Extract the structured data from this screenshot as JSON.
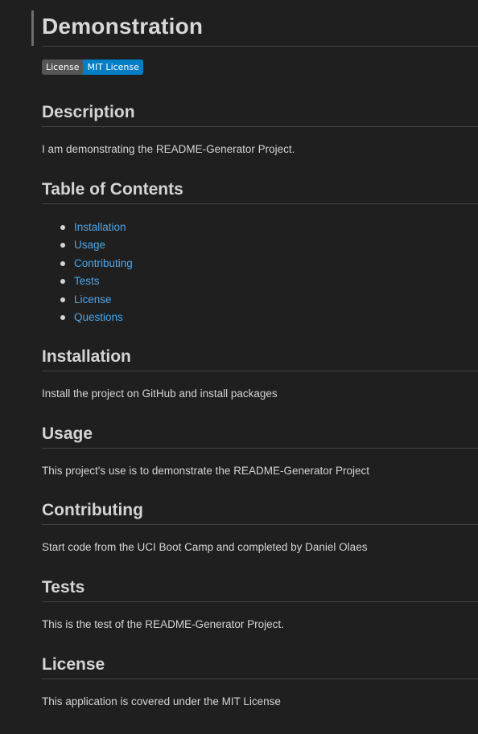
{
  "title": "Demonstration",
  "badge": {
    "left": "License",
    "right": "MIT License",
    "left_color": "#555555",
    "right_color": "#007ec6"
  },
  "sections": {
    "description": {
      "heading": "Description",
      "text": "I am demonstrating the README-Generator Project."
    },
    "toc": {
      "heading": "Table of Contents",
      "items": [
        "Installation",
        "Usage",
        "Contributing",
        "Tests",
        "License",
        "Questions"
      ]
    },
    "installation": {
      "heading": "Installation",
      "text": "Install the project on GitHub and install packages"
    },
    "usage": {
      "heading": "Usage",
      "text": "This project's use is to demonstrate the README-Generator Project"
    },
    "contributing": {
      "heading": "Contributing",
      "text": "Start code from the UCI Boot Camp and completed by Daniel Olaes"
    },
    "tests": {
      "heading": "Tests",
      "text": "This is the test of the README-Generator Project."
    },
    "license": {
      "heading": "License",
      "text": "This application is covered under the MIT License"
    }
  },
  "colors": {
    "background": "#1f1f1f",
    "link": "#4ea6ea",
    "text": "#d4d4d4"
  }
}
